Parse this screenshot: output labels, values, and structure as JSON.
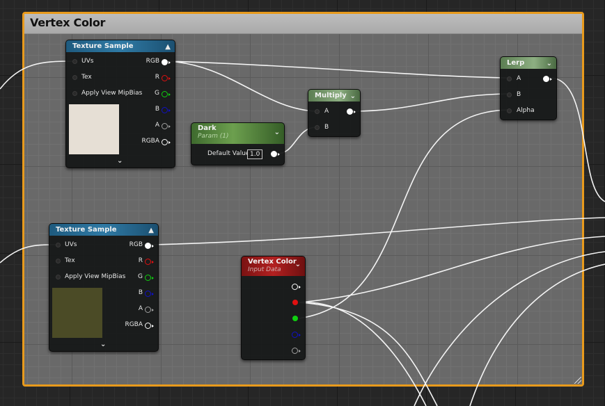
{
  "comment": {
    "title": "Vertex Color"
  },
  "nodes": {
    "texture_top": {
      "title": "Texture Sample",
      "inputs": [
        "UVs",
        "Tex",
        "Apply View MipBias"
      ],
      "outputs": [
        "RGB",
        "R",
        "G",
        "B",
        "A",
        "RGBA"
      ],
      "preview_color": "#e6dfd5"
    },
    "texture_bottom": {
      "title": "Texture Sample",
      "inputs": [
        "UVs",
        "Tex",
        "Apply View MipBias"
      ],
      "outputs": [
        "RGB",
        "R",
        "G",
        "B",
        "A",
        "RGBA"
      ],
      "preview_color": "#4b4b26"
    },
    "dark_param": {
      "title": "Dark",
      "subtitle": "Param (1)",
      "default_label": "Default Value",
      "default_value": "1.0"
    },
    "multiply": {
      "title": "Multiply",
      "inputs": [
        "A",
        "B"
      ]
    },
    "lerp": {
      "title": "Lerp",
      "inputs": [
        "A",
        "B",
        "Alpha"
      ]
    },
    "vertex_color": {
      "title": "Vertex Color",
      "subtitle": "Input Data"
    }
  },
  "colors": {
    "comment_border": "#e89a1c",
    "pin_red": "#e01010",
    "pin_green": "#10d010",
    "pin_blue": "#1010c8",
    "pin_alpha": "#a0a0a0"
  }
}
